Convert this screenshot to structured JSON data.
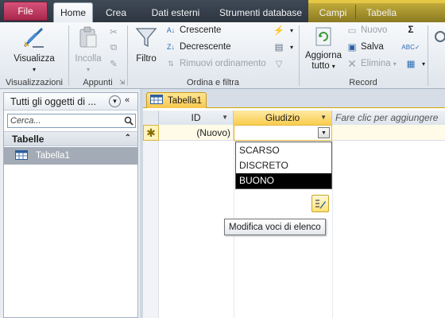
{
  "tabs": {
    "file": "File",
    "home": "Home",
    "crea": "Crea",
    "dati_esterni": "Dati esterni",
    "strumenti_database": "Strumenti database",
    "campi": "Campi",
    "tabella": "Tabella"
  },
  "ribbon": {
    "visualizzazioni": {
      "button": "Visualizza",
      "label": "Visualizzazioni"
    },
    "appunti": {
      "incolla": "Incolla",
      "label": "Appunti"
    },
    "ordina": {
      "filtro": "Filtro",
      "crescente": "Crescente",
      "decrescente": "Decrescente",
      "rimuovi": "Rimuovi ordinamento",
      "label": "Ordina e filtra"
    },
    "record": {
      "aggiorna_line1": "Aggiorna",
      "aggiorna_line2": "tutto",
      "nuovo": "Nuovo",
      "salva": "Salva",
      "elimina": "Elimina",
      "label": "Record"
    }
  },
  "nav": {
    "header": "Tutti gli oggetti di ...",
    "search_placeholder": "Cerca...",
    "section": "Tabelle",
    "items": [
      "Tabella1"
    ]
  },
  "document": {
    "tab": "Tabella1",
    "columns": {
      "id": "ID",
      "giudizio": "Giudizio",
      "add": "Fare clic per aggiungere"
    },
    "new_row_id": "(Nuovo)",
    "new_row_marker": "✱",
    "dropdown_options": [
      "SCARSO",
      "DISCRETO",
      "BUONO"
    ],
    "selected_option": "BUONO",
    "tooltip": "Modifica voci di elenco"
  },
  "colors": {
    "file_tab": "#c43a63",
    "context_tabs": "#b19c2f",
    "active_header": "#f9cc4e"
  }
}
